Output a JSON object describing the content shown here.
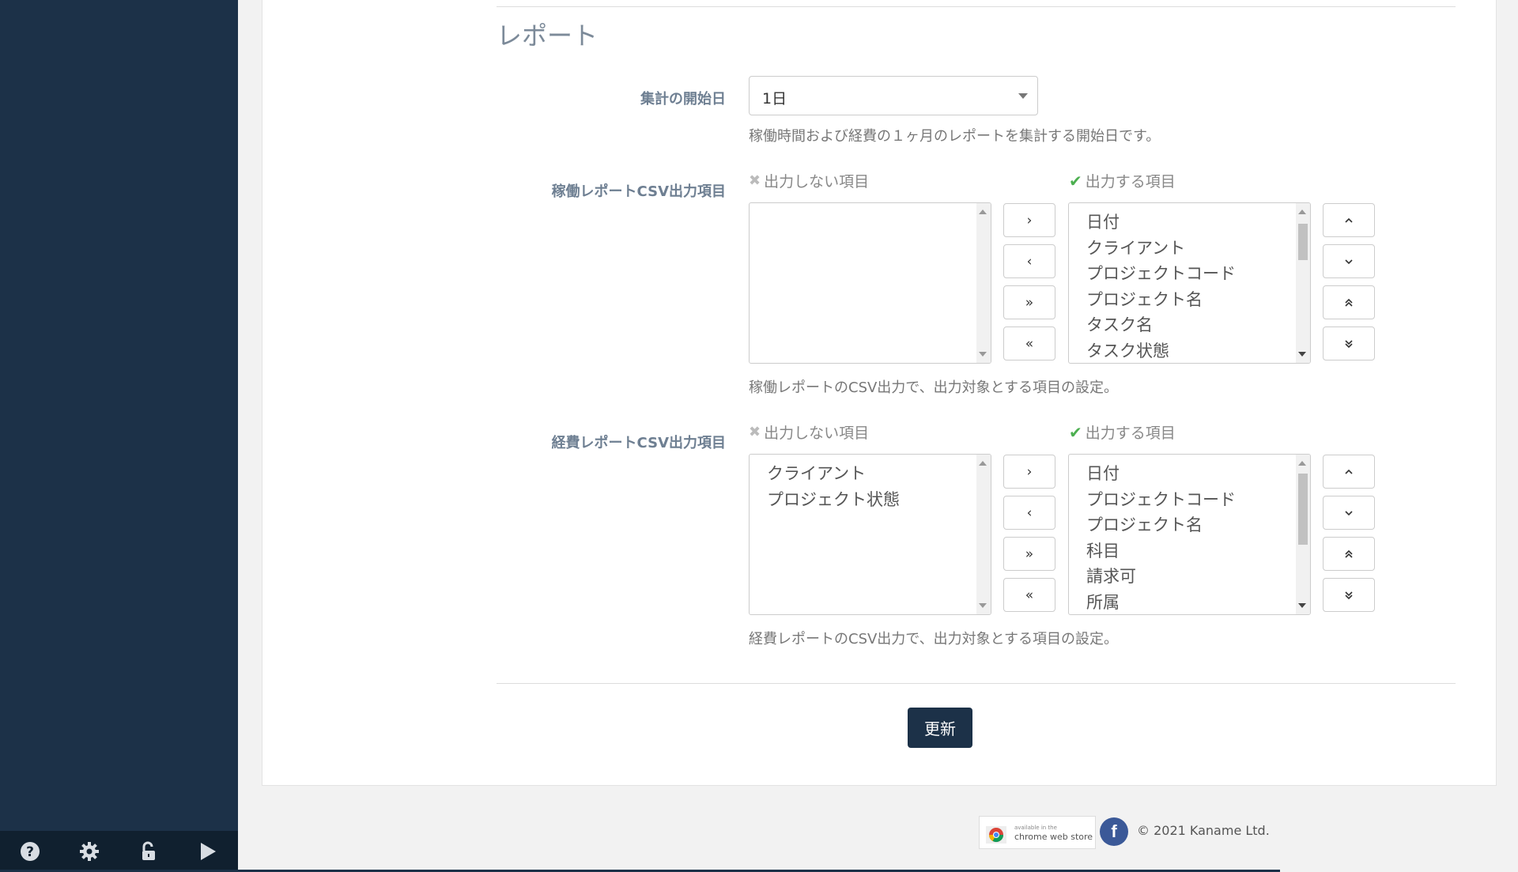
{
  "section_title": "レポート",
  "start_day": {
    "label": "集計の開始日",
    "value": "1日",
    "help": "稼働時間および経費の１ヶ月のレポートを集計する開始日です。"
  },
  "work_csv": {
    "label": "稼働レポートCSV出力項目",
    "excluded_caption": "出力しない項目",
    "included_caption": "出力する項目",
    "excluded_items": [],
    "included_items": [
      "日付",
      "クライアント",
      "プロジェクトコード",
      "プロジェクト名",
      "タスク名",
      "タスク状態"
    ],
    "help": "稼働レポートのCSV出力で、出力対象とする項目の設定。"
  },
  "expense_csv": {
    "label": "経費レポートCSV出力項目",
    "excluded_caption": "出力しない項目",
    "included_caption": "出力する項目",
    "excluded_items": [
      "クライアント",
      "プロジェクト状態"
    ],
    "included_items": [
      "日付",
      "プロジェクトコード",
      "プロジェクト名",
      "科目",
      "請求可",
      "所属"
    ],
    "help": "経費レポートのCSV出力で、出力対象とする項目の設定。"
  },
  "buttons": {
    "move_right": "›",
    "move_left": "‹",
    "move_all_right": "»",
    "move_all_left": "«",
    "move_up": "ˆ",
    "move_down": "ˇ",
    "move_top": "⌃",
    "move_bottom": "⌄"
  },
  "submit_label": "更新",
  "footer": {
    "cws_small": "available in the",
    "cws_big": "chrome web store",
    "facebook": "f",
    "copyright": "© 2021 Kaname Ltd."
  },
  "colors": {
    "sidebar": "#1c3148",
    "accent_check": "#4caf50",
    "facebook": "#3b5998"
  }
}
